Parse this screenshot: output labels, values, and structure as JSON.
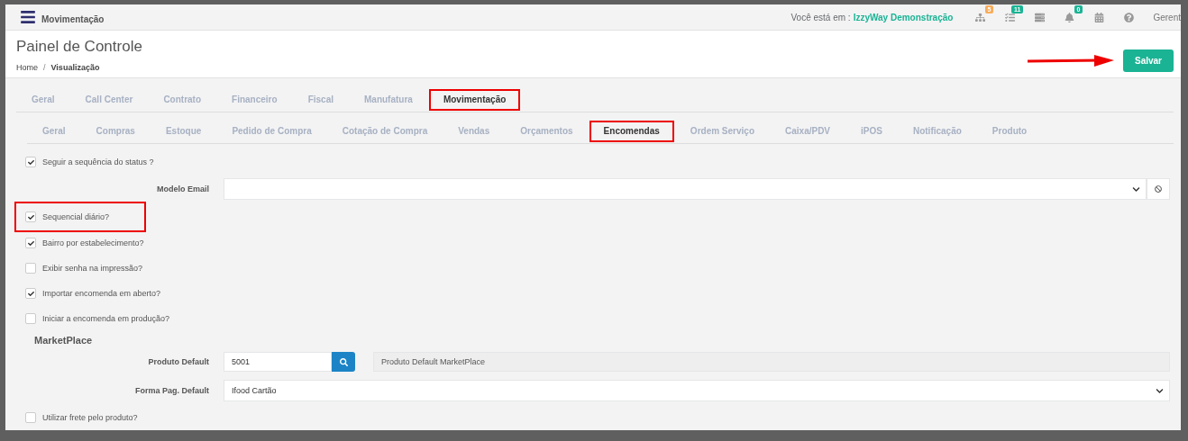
{
  "header": {
    "title": "Movimentação",
    "location_label": "Você está em :",
    "location_value": "IzzyWay Demonstração",
    "icons": [
      {
        "kind": "sitemap",
        "badge": "5",
        "color": "#f8ac59"
      },
      {
        "kind": "tasks",
        "badge": "11",
        "color": "#1ab394"
      },
      {
        "kind": "server"
      },
      {
        "kind": "bell",
        "badge": "0",
        "color": "#1ab394"
      },
      {
        "kind": "calendar"
      },
      {
        "kind": "help"
      }
    ],
    "user": "Gerent"
  },
  "page": {
    "title": "Painel de Controle",
    "breadcrumb": [
      "Home",
      "Visualização"
    ],
    "breadcrumb_separator": "/",
    "save_button": "Salvar"
  },
  "tabs": [
    {
      "label": "Geral",
      "selected": false
    },
    {
      "label": "Call Center",
      "selected": false
    },
    {
      "label": "Contrato",
      "selected": false
    },
    {
      "label": "Financeiro",
      "selected": false
    },
    {
      "label": "Fiscal",
      "selected": false
    },
    {
      "label": "Manufatura",
      "selected": false
    },
    {
      "label": "Movimentação",
      "selected": true
    }
  ],
  "subtabs": [
    {
      "label": "Geral",
      "selected": false
    },
    {
      "label": "Compras",
      "selected": false
    },
    {
      "label": "Estoque",
      "selected": false
    },
    {
      "label": "Pedido de Compra",
      "selected": false
    },
    {
      "label": "Cotação de Compra",
      "selected": false
    },
    {
      "label": "Vendas",
      "selected": false
    },
    {
      "label": "Orçamentos",
      "selected": false
    },
    {
      "label": "Encomendas",
      "selected": true
    },
    {
      "label": "Ordem Serviço",
      "selected": false
    },
    {
      "label": "Caixa/PDV",
      "selected": false
    },
    {
      "label": "iPOS",
      "selected": false
    },
    {
      "label": "Notificação",
      "selected": false
    },
    {
      "label": "Produto",
      "selected": false
    }
  ],
  "form": [
    {
      "kind": "checkbox",
      "label": "Seguir a sequência do status ?",
      "checked": true
    },
    {
      "kind": "select",
      "label": "Modelo Email"
    },
    {
      "kind": "checkbox",
      "label": "Sequencial diário?",
      "checked": true,
      "highlight": true
    },
    {
      "kind": "checkbox",
      "label": "Bairro por estabelecimento?",
      "checked": true
    },
    {
      "kind": "checkbox",
      "label": "Exibir senha na impressão?",
      "checked": false
    },
    {
      "kind": "checkbox",
      "label": "Importar encomenda em aberto?",
      "checked": true
    },
    {
      "kind": "checkbox",
      "label": "Iniciar a encomenda em produção?",
      "checked": false
    },
    {
      "kind": "heading",
      "label": "MarketPlace"
    },
    {
      "kind": "lookup",
      "label": "Produto Default",
      "value": "5001",
      "description": "Produto Default MarketPlace"
    },
    {
      "kind": "select",
      "label": "Forma Pag. Default",
      "value": "Ifood Cartão"
    },
    {
      "kind": "checkbox",
      "label": "Utilizar frete pelo produto?",
      "checked": false
    }
  ]
}
